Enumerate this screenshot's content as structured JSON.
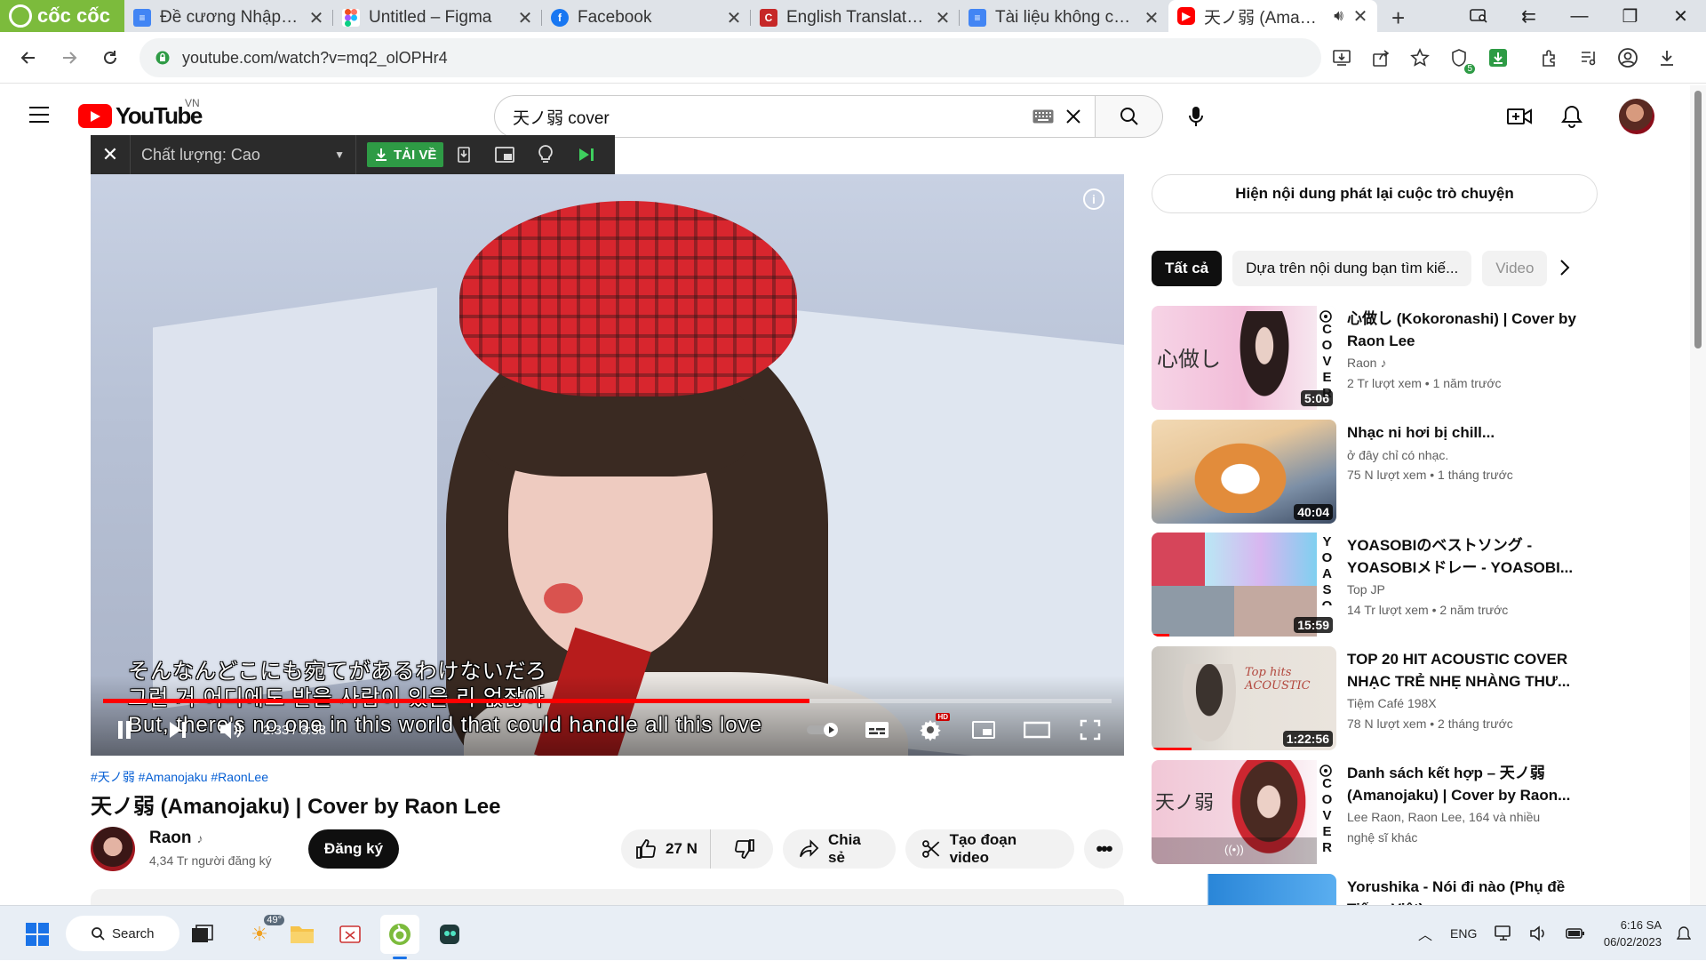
{
  "browser": {
    "brand": "cốc cốc",
    "tabs": [
      {
        "title": "Đề cương Nhập môn",
        "icon": "google-docs-icon",
        "color": "#4285f4"
      },
      {
        "title": "Untitled – Figma",
        "icon": "figma-icon",
        "color": "#f24e1e"
      },
      {
        "title": "Facebook",
        "icon": "facebook-icon",
        "color": "#1877f2"
      },
      {
        "title": "English Translation c",
        "icon": "c-icon",
        "color": "#c62828"
      },
      {
        "title": "Tài liệu không có tiê",
        "icon": "google-docs-icon",
        "color": "#4285f4"
      },
      {
        "title": "天ノ弱 (Amanoja",
        "icon": "youtube-icon",
        "color": "#ff0000"
      }
    ],
    "url": "youtube.com/watch?v=mq2_olOPHr4",
    "extension_badge": "5"
  },
  "youtube": {
    "logo": "YouTube",
    "country": "VN",
    "search_value": "天ノ弱 cover"
  },
  "downloader": {
    "quality_label": "Chất lượng: Cao",
    "download_label": "TẢI VỀ"
  },
  "player": {
    "subtitles": [
      "そんなんどこにも宛てがあるわけないだろ",
      "그런 거 어디에도 받을 사람이 있을 리 없잖아",
      "But, there's no one in this world that could handle all this love"
    ],
    "current_time": "2:33",
    "duration": "3:38",
    "progress_fraction": 0.7,
    "hd_badge": "HD",
    "accent": "#ff0000"
  },
  "video": {
    "hashtags": "#天ノ弱 #Amanojaku #RaonLee",
    "title": "天ノ弱 (Amanojaku) | Cover by Raon Lee",
    "channel": "Raon",
    "subscribers": "4,34 Tr người đăng ký",
    "subscribe_label": "Đăng ký",
    "likes": "27 N",
    "share_label": "Chia sẻ",
    "clip_label": "Tạo đoạn video"
  },
  "sidebar": {
    "chat_replay": "Hiện nội dung phát lại cuộc trò chuyện",
    "chips": [
      "Tất cả",
      "Dựa trên nội dung bạn tìm kiế...",
      "Video"
    ],
    "recommendations": [
      {
        "title": "心做し (Kokoronashi) | Cover by Raon Lee",
        "channel": "Raon",
        "views": "2 Tr lượt xem",
        "age": "1 năm trước",
        "duration": "5:06",
        "side_text": "COVER",
        "verified_music": true
      },
      {
        "title": "Nhạc ni hơi bị chill...",
        "channel": "ở đây chỉ có nhạc.",
        "views": "75 N lượt xem",
        "age": "1 tháng trước",
        "duration": "40:04"
      },
      {
        "title": "YOASOBIのベストソング - YOASOBIメドレー - YOASOBI...",
        "channel": "Top JP",
        "views": "14 Tr lượt xem",
        "age": "2 năm trước",
        "duration": "15:59",
        "side_text": "YOASOBI"
      },
      {
        "title": "TOP 20 HIT ACOUSTIC COVER NHẠC TRẺ NHẸ NHÀNG THƯ...",
        "channel": "Tiệm Café 198X",
        "views": "78 N lượt xem",
        "age": "2 tháng trước",
        "duration": "1:22:56"
      },
      {
        "title": "Danh sách kết hợp – 天ノ弱 (Amanojaku) | Cover by Raon...",
        "channel": "Lee Raon, Raon Lee, 164 và nhiều",
        "views": "nghệ sĩ khác",
        "age": "",
        "duration": "",
        "side_text": "COVER"
      },
      {
        "title": "Yorushika - Nói đi nào (Phụ đề Tiếng Việt)",
        "channel": "",
        "views": "",
        "age": "",
        "duration": ""
      }
    ]
  },
  "taskbar": {
    "search_label": "Search",
    "weather": "49°",
    "language": "ENG",
    "time": "6:16 SA",
    "date": "06/02/2023"
  }
}
